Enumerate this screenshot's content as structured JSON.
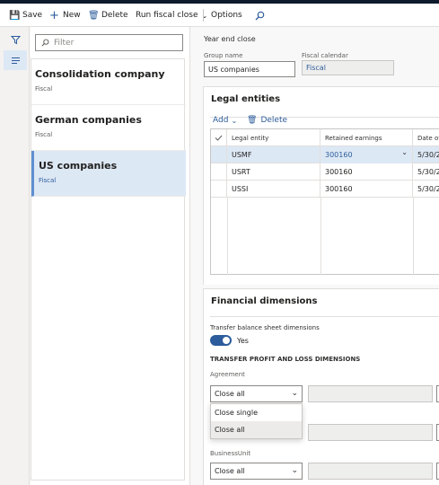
{
  "toolbar": {
    "save_label": "Save",
    "new_label": "New",
    "delete_label": "Delete",
    "run_fiscal_close_label": "Run fiscal close",
    "options_label": "Options"
  },
  "list": {
    "filter_placeholder": "Filter",
    "items": [
      {
        "title": "Consolidation company",
        "subtitle": "Fiscal"
      },
      {
        "title": "German companies",
        "subtitle": "Fiscal"
      },
      {
        "title": "US companies",
        "subtitle": "Fiscal"
      }
    ]
  },
  "header": {
    "title": "Year end close",
    "group_name_label": "Group name",
    "group_name_value": "US companies",
    "fiscal_calendar_label": "Fiscal calendar",
    "fiscal_calendar_value": "Fiscal"
  },
  "legal_entities": {
    "title": "Legal entities",
    "add_label": "Add",
    "delete_label": "Delete",
    "columns": [
      "Legal entity",
      "Retained earnings",
      "Date of"
    ],
    "rows": [
      {
        "entity": "USMF",
        "retained": "300160",
        "date": "5/30/2"
      },
      {
        "entity": "USRT",
        "retained": "300160",
        "date": "5/30/2"
      },
      {
        "entity": "USSI",
        "retained": "300160",
        "date": "5/30/2"
      }
    ]
  },
  "financial_dimensions": {
    "title": "Financial dimensions",
    "transfer_label": "Transfer balance sheet dimensions",
    "transfer_value": "Yes",
    "pl_heading": "TRANSFER PROFIT AND LOSS DIMENSIONS",
    "agreement_label": "Agreement",
    "agreement_value": "Close all",
    "dropdown_options": [
      "Close single",
      "Close all"
    ],
    "businessunit_label": "BusinessUnit",
    "businessunit_value": "Close all"
  },
  "colors": {
    "accent": "#2c5c9b",
    "selection": "#dde8f5",
    "nav_bar": "#0e1b2c"
  }
}
